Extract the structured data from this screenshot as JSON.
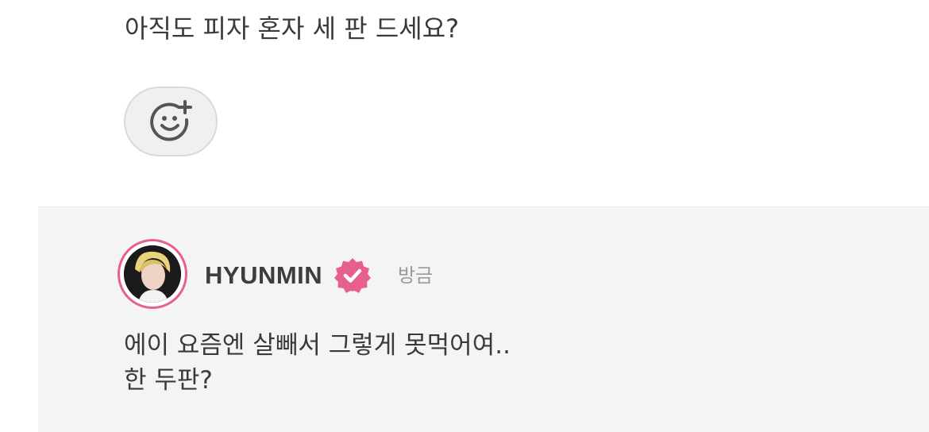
{
  "post": {
    "text": "아직도 피자 혼자 세 판 드세요?",
    "reaction_icon": "smiley-plus-icon"
  },
  "reply": {
    "avatar_icon": "user-avatar",
    "username": "HYUNMIN",
    "verified_icon": "verified-badge-icon",
    "timestamp": "방금",
    "lines": [
      "에이 요즘엔 살빼서 그렇게 못먹어여..",
      "한 두판?"
    ]
  },
  "colors": {
    "accent": "#e75f8c",
    "background": "#ffffff",
    "reply_background": "#f4f4f4",
    "text": "#3a3a3a",
    "muted": "#9a9a9a"
  }
}
